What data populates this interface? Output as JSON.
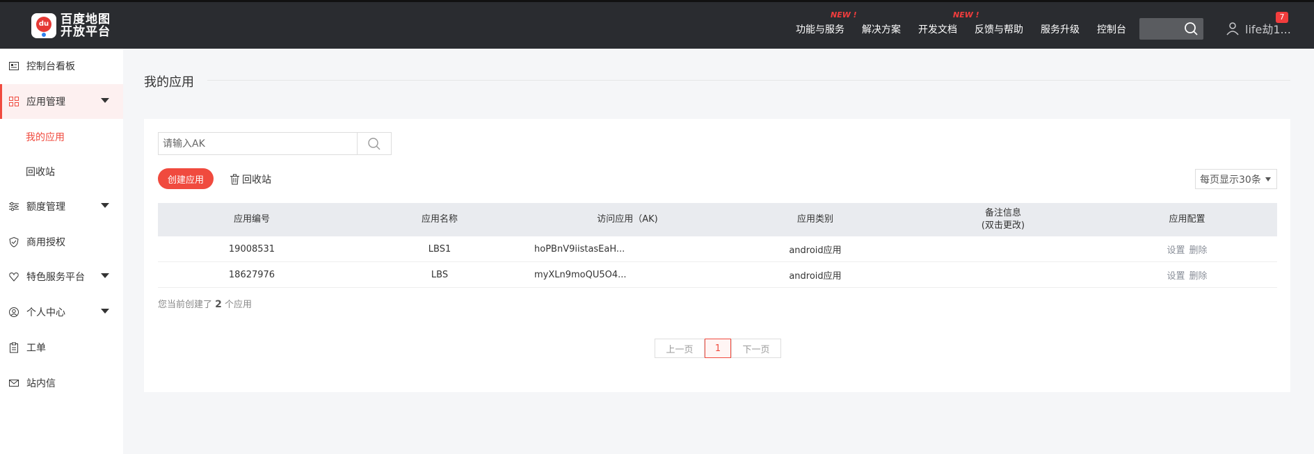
{
  "header": {
    "logo_line1": "百度地图",
    "logo_line2": "开放平台",
    "logo_mark": "du",
    "nav": [
      {
        "label": "功能与服务",
        "badge": "NEW !"
      },
      {
        "label": "解决方案",
        "badge": ""
      },
      {
        "label": "开发文档",
        "badge": "NEW !"
      },
      {
        "label": "反馈与帮助",
        "badge": ""
      },
      {
        "label": "服务升级",
        "badge": ""
      },
      {
        "label": "控制台",
        "badge": ""
      }
    ],
    "user_name": "life劫1...",
    "notification_count": "7"
  },
  "sidebar": {
    "items": [
      {
        "label": "控制台看板",
        "icon": "dashboard-icon"
      },
      {
        "label": "应用管理",
        "icon": "grid-icon"
      },
      {
        "label": "额度管理",
        "icon": "sliders-icon"
      },
      {
        "label": "商用授权",
        "icon": "shield-check-icon"
      },
      {
        "label": "特色服务平台",
        "icon": "heart-shield-icon"
      },
      {
        "label": "个人中心",
        "icon": "user-circle-icon"
      },
      {
        "label": "工单",
        "icon": "clipboard-icon"
      },
      {
        "label": "站内信",
        "icon": "mail-icon"
      }
    ],
    "sub_items": [
      {
        "label": "我的应用"
      },
      {
        "label": "回收站"
      }
    ]
  },
  "main": {
    "title": "我的应用",
    "search_placeholder": "请输入AK",
    "create_label": "创建应用",
    "recycle_label": "回收站",
    "per_page_label": "每页显示30条",
    "columns": [
      "应用编号",
      "应用名称",
      "访问应用（AK)",
      "应用类别",
      "备注信息",
      "(双击更改)",
      "应用配置"
    ],
    "rows": [
      {
        "id": "19008531",
        "name": "LBS1",
        "ak": "hoPBnV9iistasEaH...",
        "category": "android应用",
        "note": "",
        "set": "设置",
        "del": "删除"
      },
      {
        "id": "18627976",
        "name": "LBS",
        "ak": "myXLn9moQU5O4...",
        "category": "android应用",
        "note": "",
        "set": "设置",
        "del": "删除"
      }
    ],
    "summary_prefix": "您当前创建了",
    "summary_count": "2",
    "summary_suffix": "个应用",
    "pager": {
      "prev": "上一页",
      "current": "1",
      "next": "下一页"
    }
  },
  "colors": {
    "accent": "#f04a3e",
    "header_bg": "#2a2c30"
  }
}
